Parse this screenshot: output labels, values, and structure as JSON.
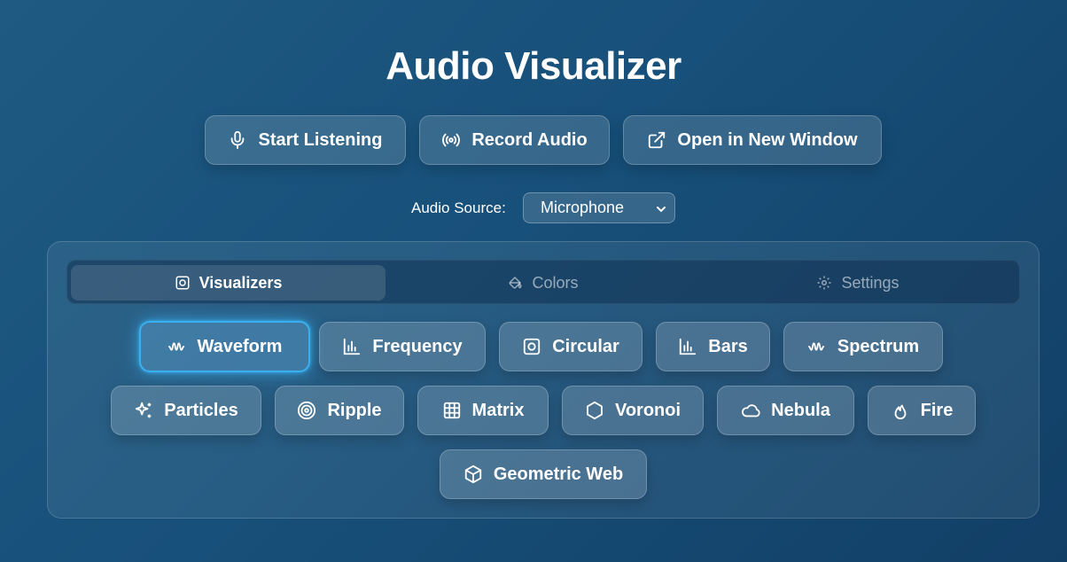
{
  "header": {
    "title": "Audio Visualizer"
  },
  "actions": {
    "start_listening": "Start Listening",
    "record_audio": "Record Audio",
    "open_new_window": "Open in New Window"
  },
  "audio_source": {
    "label": "Audio Source:",
    "selected": "Microphone"
  },
  "tabs": [
    {
      "label": "Visualizers",
      "icon": "square-circle-icon",
      "active": true
    },
    {
      "label": "Colors",
      "icon": "paint-bucket-icon",
      "active": false
    },
    {
      "label": "Settings",
      "icon": "gear-icon",
      "active": false
    }
  ],
  "visualizers": [
    {
      "label": "Waveform",
      "icon": "waveform-icon",
      "selected": true
    },
    {
      "label": "Frequency",
      "icon": "bar-chart-icon"
    },
    {
      "label": "Circular",
      "icon": "square-circle-icon"
    },
    {
      "label": "Bars",
      "icon": "bar-chart-icon"
    },
    {
      "label": "Spectrum",
      "icon": "waveform-icon"
    },
    {
      "label": "Particles",
      "icon": "sparkles-icon"
    },
    {
      "label": "Ripple",
      "icon": "target-icon"
    },
    {
      "label": "Matrix",
      "icon": "grid-icon"
    },
    {
      "label": "Voronoi",
      "icon": "hexagon-icon"
    },
    {
      "label": "Nebula",
      "icon": "cloud-icon"
    },
    {
      "label": "Fire",
      "icon": "flame-icon"
    },
    {
      "label": "Geometric Web",
      "icon": "cube-icon"
    }
  ],
  "colors": {
    "accent": "#3ab0f0",
    "background": "#17507a"
  }
}
